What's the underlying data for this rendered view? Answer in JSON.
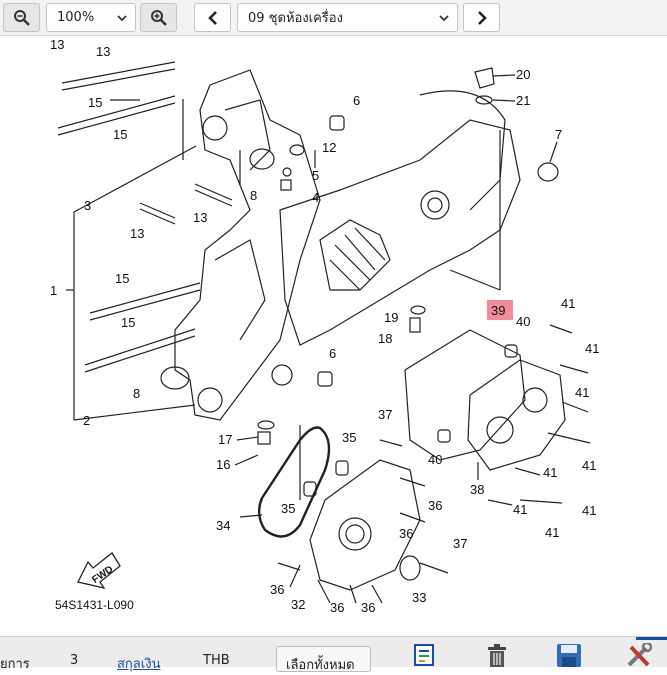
{
  "toolbar": {
    "zoom_value": "100%",
    "page_value": "09 ชุดห้องเครื่อง",
    "icons": [
      "zoom-out-icon",
      "zoom-in-icon",
      "chevron-left-icon",
      "chevron-right-icon"
    ]
  },
  "diagram": {
    "code": "54S1431-L090",
    "fwd_label": "FWD",
    "highlight_color": "#f28b9a",
    "callouts": {
      "c13a": "13",
      "c13b": "13",
      "c13c": "13",
      "c13d": "13",
      "c15a": "15",
      "c15b": "15",
      "c15c": "15",
      "c15d": "15",
      "c3": "3",
      "c1": "1",
      "c2": "2",
      "c6a": "6",
      "c6b": "6",
      "c12": "12",
      "c5": "5",
      "c4": "4",
      "c8a": "8",
      "c8b": "8",
      "c20": "20",
      "c21": "21",
      "c7": "7",
      "c39": "39",
      "c40a": "40",
      "c40b": "40",
      "c41a": "41",
      "c41b": "41",
      "c41c": "41",
      "c41d": "41",
      "c41e": "41",
      "c41f": "41",
      "c41g": "41",
      "c19": "19",
      "c18": "18",
      "c17": "17",
      "c16": "16",
      "c35a": "35",
      "c35b": "35",
      "c34": "34",
      "c37a": "37",
      "c37b": "37",
      "c38": "38",
      "c36a": "36",
      "c36b": "36",
      "c36c": "36",
      "c36d": "36",
      "c36e": "36",
      "c33": "33",
      "c32": "32"
    }
  },
  "footer": {
    "items_label": "ยการ",
    "items_count": "3",
    "currency_link": "สกุลเงิน",
    "currency_value": "THB",
    "select_all": "เลือกทั้งหมด",
    "icons": [
      "add-to-list-icon",
      "trash-icon",
      "save-disk-icon",
      "tools-icon"
    ],
    "accent_color": "#1a4ea8"
  }
}
